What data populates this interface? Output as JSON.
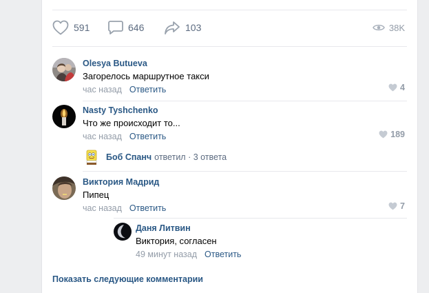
{
  "actions": {
    "likes": "591",
    "comments": "646",
    "shares": "103",
    "views": "38K"
  },
  "comments": [
    {
      "author": "Olesya Butueva",
      "text": "Загорелось маршрутное такси",
      "time": "час назад",
      "reply": "Ответить",
      "likes": "4"
    },
    {
      "author": "Nasty Tyshchenko",
      "text": "Что же происходит то...",
      "time": "час назад",
      "reply": "Ответить",
      "likes": "189"
    },
    {
      "author": "Виктория Мадрид",
      "text": "Пипец",
      "time": "час назад",
      "reply": "Ответить",
      "likes": "7"
    }
  ],
  "thread": {
    "name": "Боб Спанч",
    "text": "ответил · 3 ответа"
  },
  "reply_comment": {
    "author": "Даня Литвин",
    "text": "Виктория, согласен",
    "time": "49 минут назад",
    "reply": "Ответить"
  },
  "show_more": "Показать следующие комментарии",
  "colors": {
    "link": "#2a5885",
    "muted": "#939ca8",
    "icon": "#99a2ad",
    "background": "#edeef0"
  },
  "icons": [
    "heart-icon",
    "comment-icon",
    "share-icon",
    "eye-icon"
  ]
}
